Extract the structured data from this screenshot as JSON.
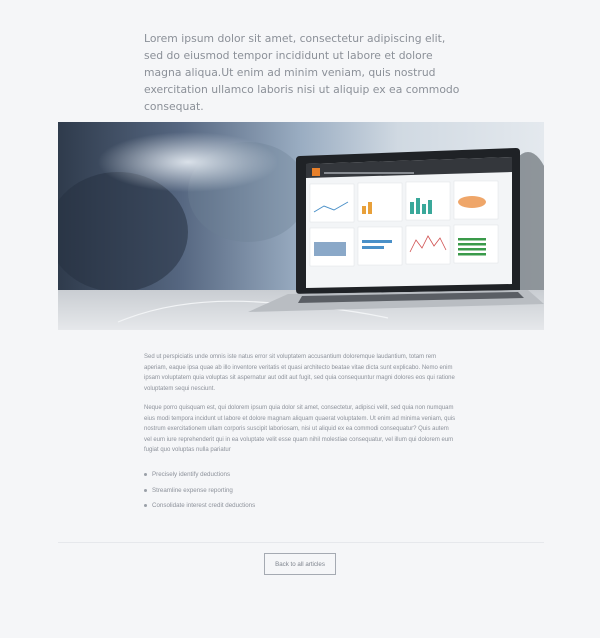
{
  "article": {
    "lead": "Lorem ipsum dolor sit amet, consectetur adipiscing elit, sed do eiusmod tempor incididunt ut labore et dolore magna aliqua.Ut enim ad minim veniam, quis nostrud exercitation ullamco laboris nisi ut aliquip ex ea commodo consequat.",
    "paragraphs": [
      "Sed ut perspiciatis unde omnis iste natus error sit voluptatem accusantium doloremque laudantium, totam rem aperiam, eaque ipsa quae ab illo inventore veritatis et quasi architecto beatae vitae dicta sunt explicabo. Nemo enim ipsam voluptatem quia voluptas sit aspernatur aut odit aut fugit, sed quia consequuntur magni dolores eos qui ratione voluptatem sequi nesciunt.",
      "Neque porro quisquam est, qui dolorem ipsum quia dolor sit amet, consectetur, adipisci velit, sed quia non numquam eius modi tempora incidunt ut labore et dolore magnam aliquam quaerat voluptatem. Ut enim ad minima veniam, quis nostrum exercitationem ullam corporis suscipit laboriosam, nisi ut aliquid ex ea commodi consequatur? Quis autem vel eum iure reprehenderit qui in ea voluptate velit esse quam nihil molestiae consequatur, vel illum qui dolorem eum fugiat quo voluptas nulla pariatur"
    ],
    "bullets": [
      "Precisely identify deductions",
      "Streamline expense reporting",
      "Consolidate interest credit deductions"
    ],
    "back_label": "Back to all articles"
  },
  "colors": {
    "page_background": "#f5f6f8",
    "text": "#8a8f98",
    "button_border": "#a5aab2",
    "screen_accent": "#e8802a"
  },
  "icons": {
    "bullet": "bullet-dot-icon",
    "brand_logo": "orange-square-logo"
  }
}
